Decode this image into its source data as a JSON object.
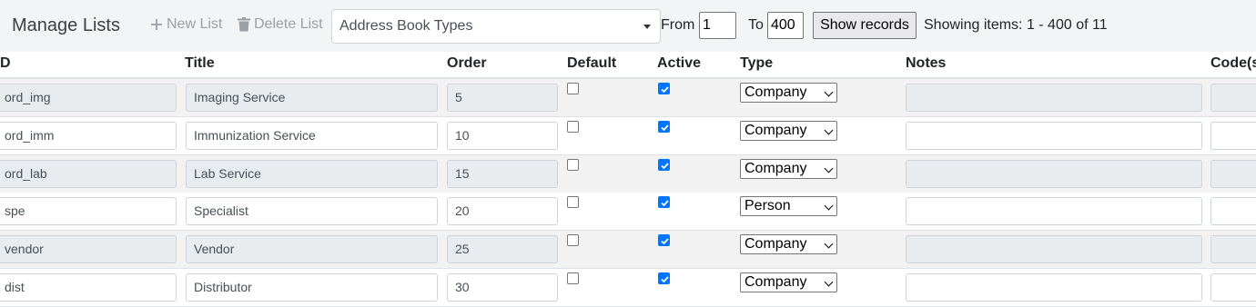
{
  "header": {
    "title": "Manage Lists",
    "new_list_label": "New List",
    "delete_list_label": "Delete List",
    "list_selected": "Address Book Types",
    "from_label": "From",
    "from_value": "1",
    "to_label": "To",
    "to_value": "400",
    "show_button_label": "Show records",
    "showing_text": "Showing items: 1 - 400 of 11"
  },
  "columns": {
    "id": "D",
    "title": "Title",
    "order": "Order",
    "default": "Default",
    "active": "Active",
    "type": "Type",
    "notes": "Notes",
    "codes": "Code(s"
  },
  "rows": [
    {
      "id": "ord_img",
      "title": "Imaging Service",
      "order": "5",
      "default": false,
      "active": true,
      "type": "Company",
      "notes": ""
    },
    {
      "id": "ord_imm",
      "title": "Immunization Service",
      "order": "10",
      "default": false,
      "active": true,
      "type": "Company",
      "notes": ""
    },
    {
      "id": "ord_lab",
      "title": "Lab Service",
      "order": "15",
      "default": false,
      "active": true,
      "type": "Company",
      "notes": ""
    },
    {
      "id": "spe",
      "title": "Specialist",
      "order": "20",
      "default": false,
      "active": true,
      "type": "Person",
      "notes": ""
    },
    {
      "id": "vendor",
      "title": "Vendor",
      "order": "25",
      "default": false,
      "active": true,
      "type": "Company",
      "notes": ""
    },
    {
      "id": "dist",
      "title": "Distributor",
      "order": "30",
      "default": false,
      "active": true,
      "type": "Company",
      "notes": ""
    }
  ],
  "icons": {
    "new_list": "plus-icon",
    "delete_list": "trash-icon"
  },
  "colors": {
    "accent": "#0075ff",
    "toolbar_bg": "#f3f4f6",
    "muted_text": "#9aa0a6"
  }
}
